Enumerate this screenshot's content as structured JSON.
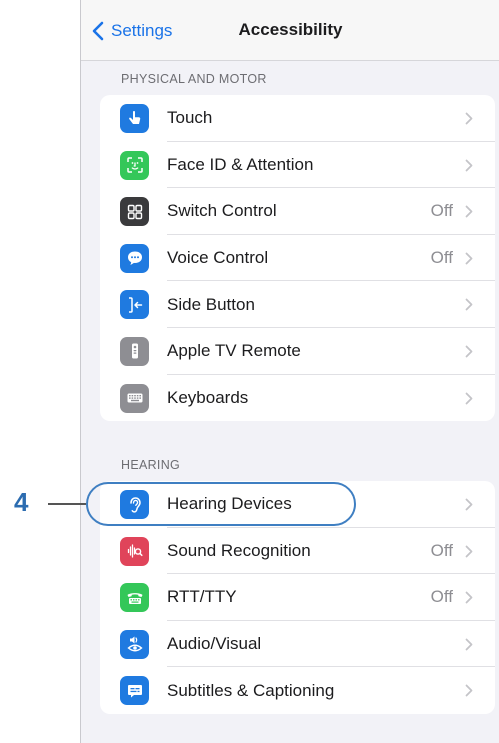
{
  "navbar": {
    "back_label": "Settings",
    "title": "Accessibility"
  },
  "sections": [
    {
      "header": "PHYSICAL AND MOTOR",
      "items": [
        {
          "label": "Touch",
          "value": "",
          "icon": "hand-pointing-icon",
          "color": "#1f7ae0"
        },
        {
          "label": "Face ID & Attention",
          "value": "",
          "icon": "face-id-icon",
          "color": "#34c759"
        },
        {
          "label": "Switch Control",
          "value": "Off",
          "icon": "switch-grid-icon",
          "color": "#3a3a3c"
        },
        {
          "label": "Voice Control",
          "value": "Off",
          "icon": "voice-bubble-icon",
          "color": "#1f7ae0"
        },
        {
          "label": "Side Button",
          "value": "",
          "icon": "side-button-icon",
          "color": "#1f7ae0"
        },
        {
          "label": "Apple TV Remote",
          "value": "",
          "icon": "tv-remote-icon",
          "color": "#8e8e93"
        },
        {
          "label": "Keyboards",
          "value": "",
          "icon": "keyboard-icon",
          "color": "#8e8e93"
        }
      ]
    },
    {
      "header": "HEARING",
      "items": [
        {
          "label": "Hearing Devices",
          "value": "",
          "icon": "ear-icon",
          "color": "#1f7ae0"
        },
        {
          "label": "Sound Recognition",
          "value": "Off",
          "icon": "sound-wave-icon",
          "color": "#e0445a"
        },
        {
          "label": "RTT/TTY",
          "value": "Off",
          "icon": "tty-phone-icon",
          "color": "#34c759"
        },
        {
          "label": "Audio/Visual",
          "value": "",
          "icon": "speaker-eye-icon",
          "color": "#1f7ae0"
        },
        {
          "label": "Subtitles & Captioning",
          "value": "",
          "icon": "captions-icon",
          "color": "#1f7ae0"
        }
      ]
    }
  ],
  "callout": {
    "number": "4"
  }
}
